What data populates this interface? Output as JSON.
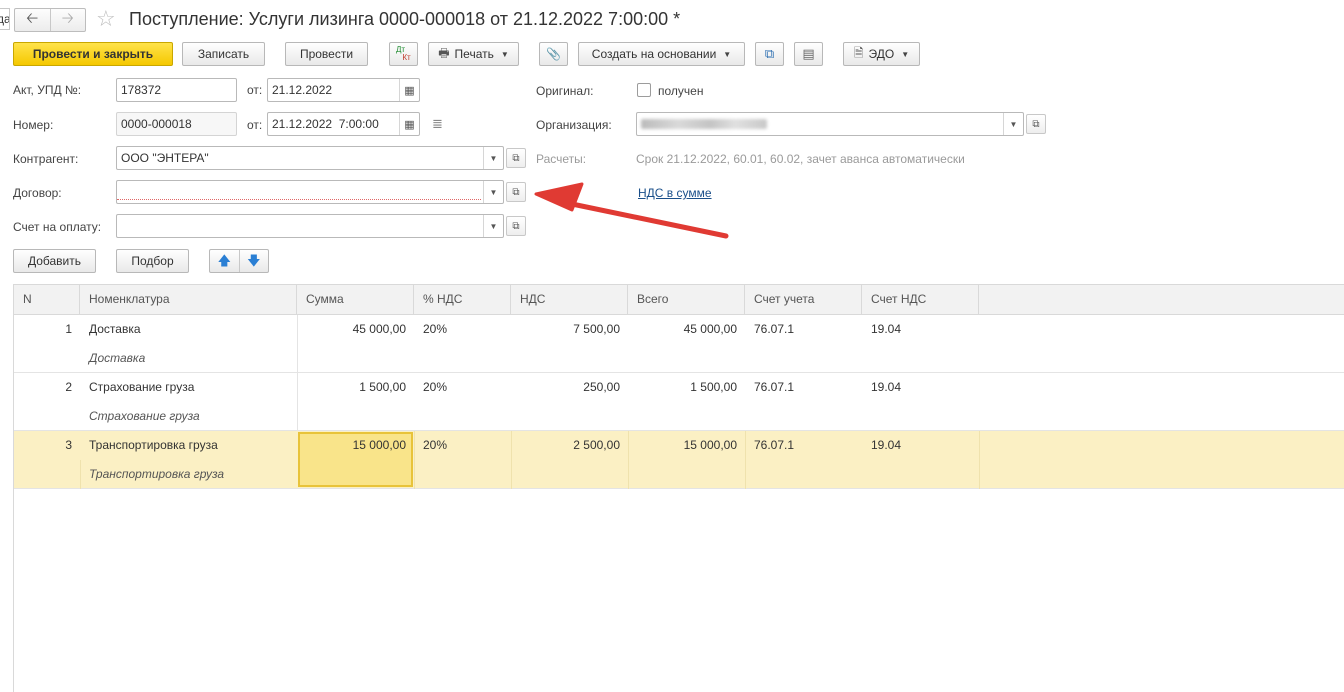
{
  "window": {
    "left_tab_text": "да",
    "title": "Поступление: Услуги лизинга 0000-000018 от 21.12.2022 7:00:00 *"
  },
  "toolbar": {
    "post_close": "Провести и закрыть",
    "save": "Записать",
    "post": "Провести",
    "dtkt_top": "Дт",
    "dtkt_bottom": "Кт",
    "print": "Печать",
    "create_based": "Создать на основании",
    "edo": "ЭДО"
  },
  "form": {
    "act_label": "Акт, УПД №:",
    "act_value": "178372",
    "from_label": "от:",
    "act_date": "21.12.2022",
    "number_label": "Номер:",
    "number_value": "0000-000018",
    "number_date": "21.12.2022  7:00:00",
    "counterparty_label": "Контрагент:",
    "counterparty_value": "ООО \"ЭНТЕРА\"",
    "contract_label": "Договор:",
    "contract_value": "",
    "invoice_label": "Счет на оплату:",
    "invoice_value": "",
    "original_label": "Оригинал:",
    "original_checkbox_label": "получен",
    "org_label": "Организация:",
    "settlements_label": "Расчеты:",
    "settlements_value": "Срок 21.12.2022, 60.01, 60.02, зачет аванса автоматически",
    "vat_link": "НДС в сумме"
  },
  "table_toolbar": {
    "add": "Добавить",
    "pick": "Подбор"
  },
  "table": {
    "columns": [
      "N",
      "Номенклатура",
      "Сумма",
      "% НДС",
      "НДС",
      "Всего",
      "Счет учета",
      "Счет НДС"
    ],
    "rows": [
      {
        "n": "1",
        "item": "Доставка",
        "content": "Доставка",
        "sum": "45 000,00",
        "vat_rate": "20%",
        "vat": "7 500,00",
        "total": "45 000,00",
        "account": "76.07.1",
        "vat_account": "19.04"
      },
      {
        "n": "2",
        "item": "Страхование груза",
        "content": "Страхование груза",
        "sum": "1 500,00",
        "vat_rate": "20%",
        "vat": "250,00",
        "total": "1 500,00",
        "account": "76.07.1",
        "vat_account": "19.04"
      },
      {
        "n": "3",
        "item": "Транспортировка груза",
        "content": "Транспортировка груза",
        "sum": "15 000,00",
        "vat_rate": "20%",
        "vat": "2 500,00",
        "total": "15 000,00",
        "account": "76.07.1",
        "vat_account": "19.04"
      }
    ],
    "selected_row": 3
  },
  "colors": {
    "primary_button": "#f5c800",
    "selected_row": "#fbf0c4",
    "current_cell": "#f9e48a",
    "annotation_arrow": "#e03a33",
    "link": "#1a4f8a"
  }
}
